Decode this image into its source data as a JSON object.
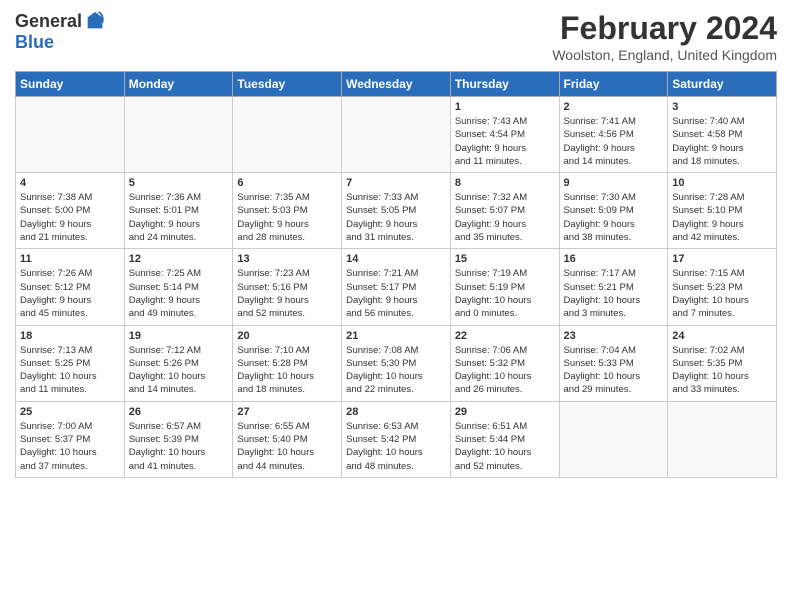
{
  "header": {
    "logo_general": "General",
    "logo_blue": "Blue",
    "title": "February 2024",
    "location": "Woolston, England, United Kingdom"
  },
  "weekdays": [
    "Sunday",
    "Monday",
    "Tuesday",
    "Wednesday",
    "Thursday",
    "Friday",
    "Saturday"
  ],
  "weeks": [
    [
      {
        "day": "",
        "info": ""
      },
      {
        "day": "",
        "info": ""
      },
      {
        "day": "",
        "info": ""
      },
      {
        "day": "",
        "info": ""
      },
      {
        "day": "1",
        "info": "Sunrise: 7:43 AM\nSunset: 4:54 PM\nDaylight: 9 hours\nand 11 minutes."
      },
      {
        "day": "2",
        "info": "Sunrise: 7:41 AM\nSunset: 4:56 PM\nDaylight: 9 hours\nand 14 minutes."
      },
      {
        "day": "3",
        "info": "Sunrise: 7:40 AM\nSunset: 4:58 PM\nDaylight: 9 hours\nand 18 minutes."
      }
    ],
    [
      {
        "day": "4",
        "info": "Sunrise: 7:38 AM\nSunset: 5:00 PM\nDaylight: 9 hours\nand 21 minutes."
      },
      {
        "day": "5",
        "info": "Sunrise: 7:36 AM\nSunset: 5:01 PM\nDaylight: 9 hours\nand 24 minutes."
      },
      {
        "day": "6",
        "info": "Sunrise: 7:35 AM\nSunset: 5:03 PM\nDaylight: 9 hours\nand 28 minutes."
      },
      {
        "day": "7",
        "info": "Sunrise: 7:33 AM\nSunset: 5:05 PM\nDaylight: 9 hours\nand 31 minutes."
      },
      {
        "day": "8",
        "info": "Sunrise: 7:32 AM\nSunset: 5:07 PM\nDaylight: 9 hours\nand 35 minutes."
      },
      {
        "day": "9",
        "info": "Sunrise: 7:30 AM\nSunset: 5:09 PM\nDaylight: 9 hours\nand 38 minutes."
      },
      {
        "day": "10",
        "info": "Sunrise: 7:28 AM\nSunset: 5:10 PM\nDaylight: 9 hours\nand 42 minutes."
      }
    ],
    [
      {
        "day": "11",
        "info": "Sunrise: 7:26 AM\nSunset: 5:12 PM\nDaylight: 9 hours\nand 45 minutes."
      },
      {
        "day": "12",
        "info": "Sunrise: 7:25 AM\nSunset: 5:14 PM\nDaylight: 9 hours\nand 49 minutes."
      },
      {
        "day": "13",
        "info": "Sunrise: 7:23 AM\nSunset: 5:16 PM\nDaylight: 9 hours\nand 52 minutes."
      },
      {
        "day": "14",
        "info": "Sunrise: 7:21 AM\nSunset: 5:17 PM\nDaylight: 9 hours\nand 56 minutes."
      },
      {
        "day": "15",
        "info": "Sunrise: 7:19 AM\nSunset: 5:19 PM\nDaylight: 10 hours\nand 0 minutes."
      },
      {
        "day": "16",
        "info": "Sunrise: 7:17 AM\nSunset: 5:21 PM\nDaylight: 10 hours\nand 3 minutes."
      },
      {
        "day": "17",
        "info": "Sunrise: 7:15 AM\nSunset: 5:23 PM\nDaylight: 10 hours\nand 7 minutes."
      }
    ],
    [
      {
        "day": "18",
        "info": "Sunrise: 7:13 AM\nSunset: 5:25 PM\nDaylight: 10 hours\nand 11 minutes."
      },
      {
        "day": "19",
        "info": "Sunrise: 7:12 AM\nSunset: 5:26 PM\nDaylight: 10 hours\nand 14 minutes."
      },
      {
        "day": "20",
        "info": "Sunrise: 7:10 AM\nSunset: 5:28 PM\nDaylight: 10 hours\nand 18 minutes."
      },
      {
        "day": "21",
        "info": "Sunrise: 7:08 AM\nSunset: 5:30 PM\nDaylight: 10 hours\nand 22 minutes."
      },
      {
        "day": "22",
        "info": "Sunrise: 7:06 AM\nSunset: 5:32 PM\nDaylight: 10 hours\nand 26 minutes."
      },
      {
        "day": "23",
        "info": "Sunrise: 7:04 AM\nSunset: 5:33 PM\nDaylight: 10 hours\nand 29 minutes."
      },
      {
        "day": "24",
        "info": "Sunrise: 7:02 AM\nSunset: 5:35 PM\nDaylight: 10 hours\nand 33 minutes."
      }
    ],
    [
      {
        "day": "25",
        "info": "Sunrise: 7:00 AM\nSunset: 5:37 PM\nDaylight: 10 hours\nand 37 minutes."
      },
      {
        "day": "26",
        "info": "Sunrise: 6:57 AM\nSunset: 5:39 PM\nDaylight: 10 hours\nand 41 minutes."
      },
      {
        "day": "27",
        "info": "Sunrise: 6:55 AM\nSunset: 5:40 PM\nDaylight: 10 hours\nand 44 minutes."
      },
      {
        "day": "28",
        "info": "Sunrise: 6:53 AM\nSunset: 5:42 PM\nDaylight: 10 hours\nand 48 minutes."
      },
      {
        "day": "29",
        "info": "Sunrise: 6:51 AM\nSunset: 5:44 PM\nDaylight: 10 hours\nand 52 minutes."
      },
      {
        "day": "",
        "info": ""
      },
      {
        "day": "",
        "info": ""
      }
    ]
  ]
}
